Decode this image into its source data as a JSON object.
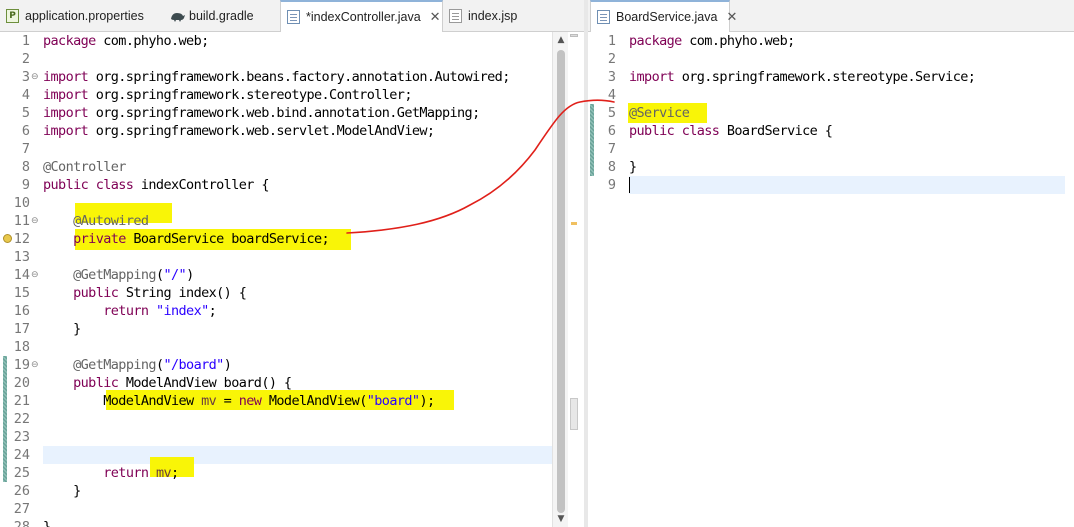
{
  "left_editor": {
    "tabs": [
      {
        "label": "application.properties",
        "icon": "properties-file-icon",
        "active": false
      },
      {
        "label": "build.gradle",
        "icon": "gradle-icon",
        "active": false
      },
      {
        "label": "*indexController.java",
        "icon": "java-file-icon",
        "active": true,
        "close": "✕"
      },
      {
        "label": "index.jsp",
        "icon": "jsp-file-icon",
        "active": false
      }
    ],
    "line_numbers": [
      "1",
      "2",
      "3",
      "4",
      "5",
      "6",
      "7",
      "8",
      "9",
      "10",
      "11",
      "12",
      "13",
      "14",
      "15",
      "16",
      "17",
      "18",
      "19",
      "20",
      "21",
      "22",
      "23",
      "24",
      "25",
      "26",
      "27",
      "28"
    ]
  },
  "right_editor": {
    "tabs": [
      {
        "label": "BoardService.java",
        "icon": "java-file-icon",
        "active": true,
        "close": "✕"
      }
    ],
    "line_numbers": [
      "1",
      "2",
      "3",
      "4",
      "5",
      "6",
      "7",
      "8",
      "9"
    ]
  },
  "colors": {
    "keyword": "#7f0055",
    "annotation": "#646464",
    "string": "#2a00ff",
    "local_variable": "#6a3e3e",
    "highlight": "#f9f507",
    "ink": "#e0201a",
    "current_line": "#e8f2fe"
  }
}
